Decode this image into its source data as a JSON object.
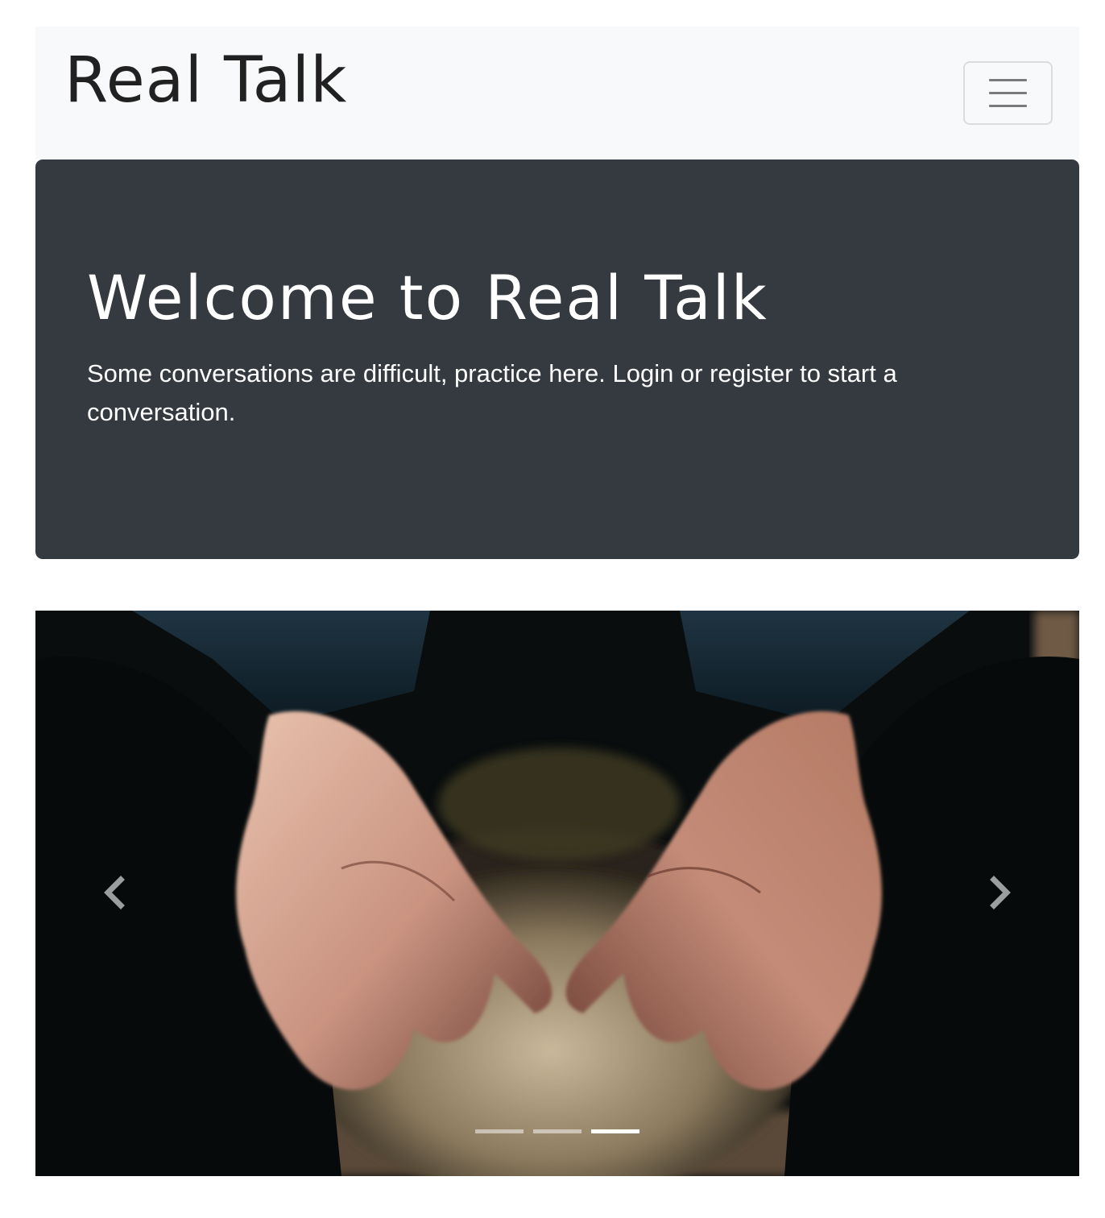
{
  "navbar": {
    "brand": "Real Talk",
    "toggler_icon": "hamburger-menu-icon"
  },
  "jumbotron": {
    "title": "Welcome to Real Talk",
    "lead": "Some conversations are difficult, practice here. Login or register to start a conversation."
  },
  "carousel": {
    "image_description": "open hands",
    "prev_icon": "chevron-left-icon",
    "next_icon": "chevron-right-icon",
    "slide_count": 3,
    "active_slide": 3
  },
  "colors": {
    "navbar_bg": "#f8f9fa",
    "jumbotron_bg": "#343a40",
    "text_dark": "#212121",
    "text_light": "#ffffff"
  }
}
